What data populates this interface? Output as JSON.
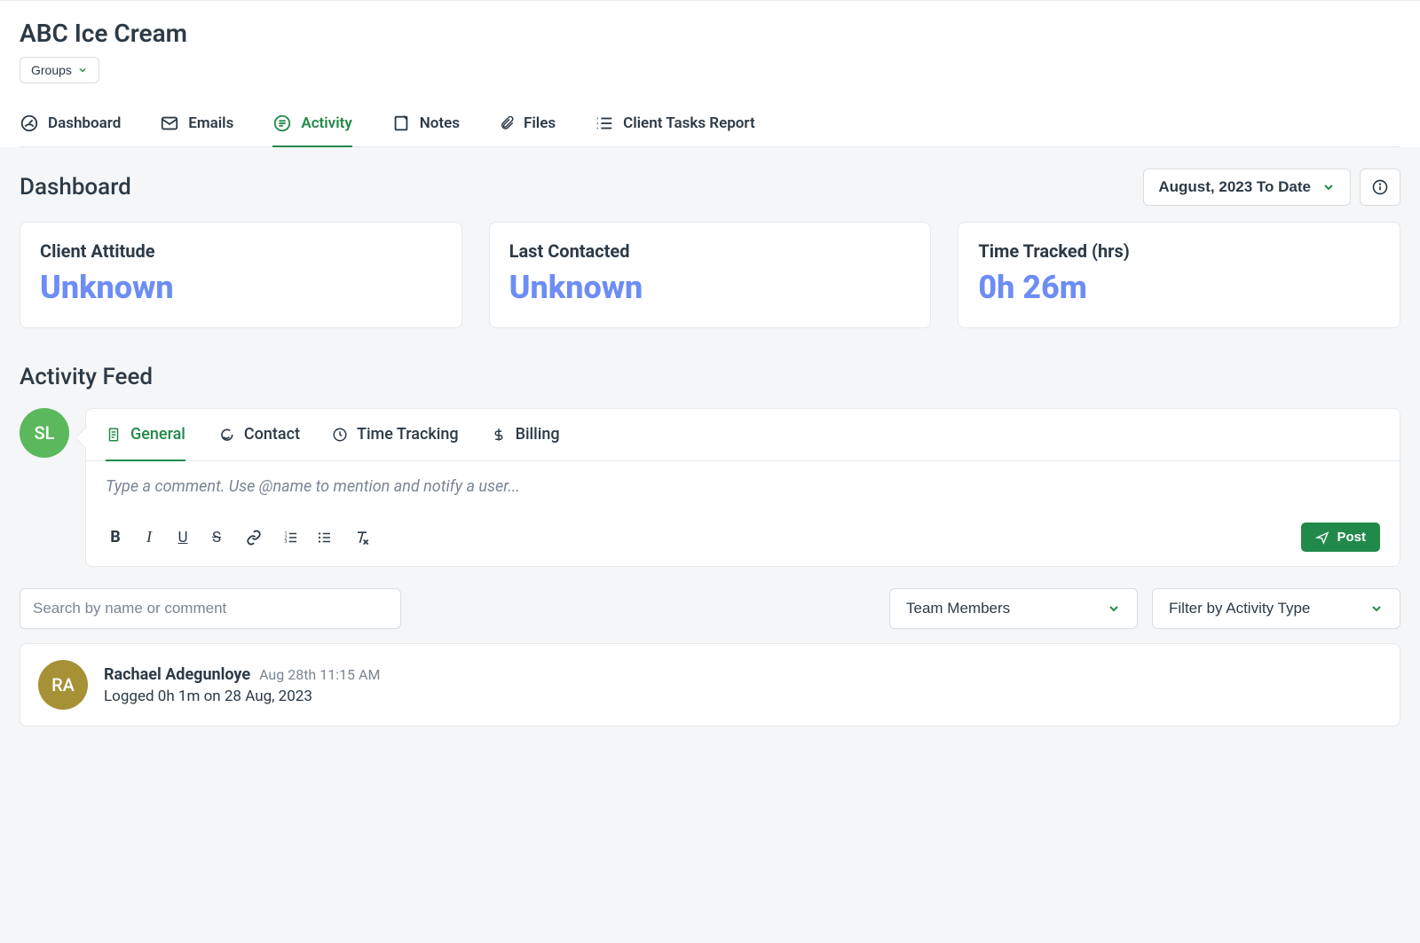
{
  "client": {
    "name": "ABC Ice Cream"
  },
  "groups_button": {
    "label": "Groups"
  },
  "nav": [
    {
      "label": "Dashboard"
    },
    {
      "label": "Emails"
    },
    {
      "label": "Activity",
      "active": true
    },
    {
      "label": "Notes"
    },
    {
      "label": "Files"
    },
    {
      "label": "Client Tasks Report"
    }
  ],
  "dashboard": {
    "title": "Dashboard",
    "date_filter": "August, 2023 To Date",
    "cards": [
      {
        "label": "Client Attitude",
        "value": "Unknown"
      },
      {
        "label": "Last Contacted",
        "value": "Unknown"
      },
      {
        "label": "Time Tracked (hrs)",
        "value": "0h 26m"
      }
    ]
  },
  "activity_feed": {
    "title": "Activity Feed",
    "composer_avatar": "SL",
    "composer_tabs": [
      {
        "label": "General",
        "active": true
      },
      {
        "label": "Contact"
      },
      {
        "label": "Time Tracking"
      },
      {
        "label": "Billing"
      }
    ],
    "composer_placeholder": "Type a comment. Use @name to mention and notify a user...",
    "post_label": "Post",
    "search_placeholder": "Search by name or comment",
    "filter_team": "Team Members",
    "filter_type": "Filter by Activity Type",
    "items": [
      {
        "avatar": "RA",
        "name": "Rachael Adegunloye",
        "timestamp": "Aug 28th 11:15 AM",
        "text": "Logged 0h 1m on 28 Aug, 2023"
      }
    ]
  }
}
